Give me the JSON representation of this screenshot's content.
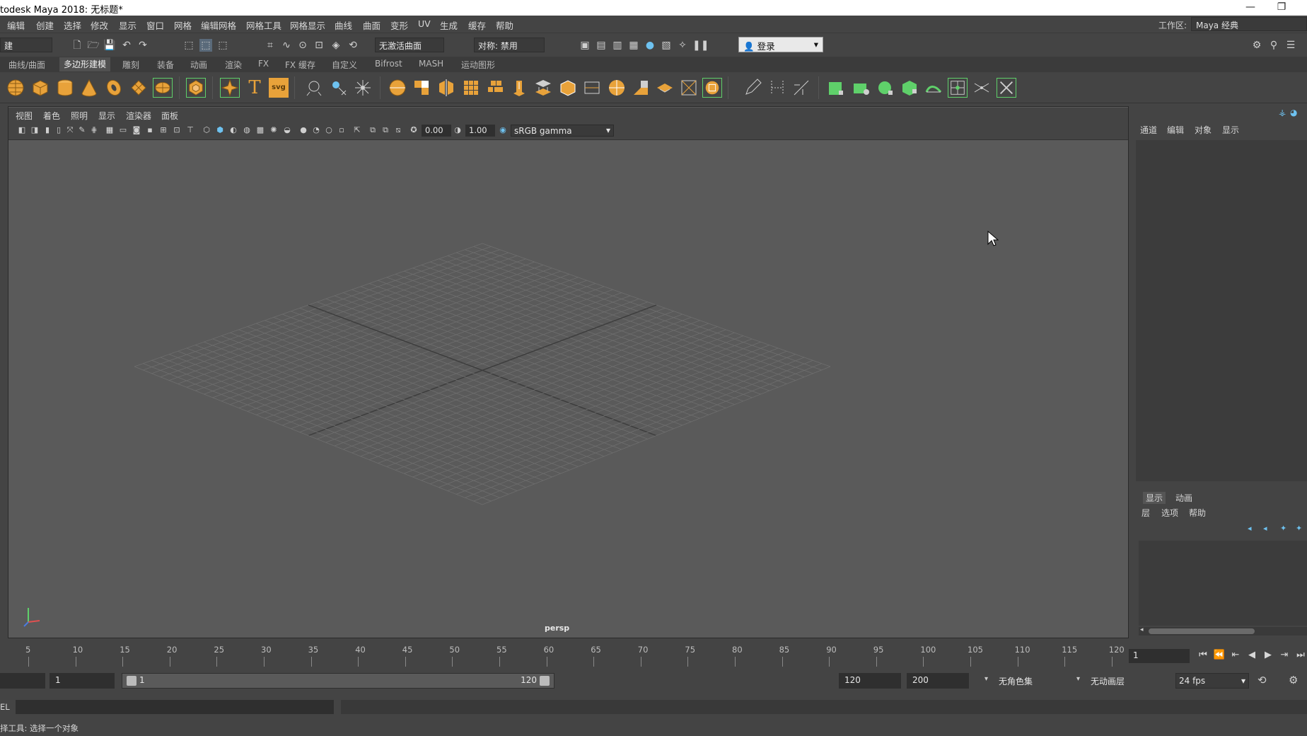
{
  "window": {
    "title": "todesk Maya 2018: 无标题*",
    "minimize": "—",
    "restore": "❐"
  },
  "menubar": {
    "items": [
      "编辑",
      "创建",
      "选择",
      "修改",
      "显示",
      "窗口",
      "网格",
      "编辑网格",
      "网格工具",
      "网格显示",
      "曲线",
      "曲面",
      "变形",
      "UV",
      "生成",
      "缓存",
      "帮助"
    ],
    "workspace_label": "工作区:",
    "workspace_value": "Maya 经典"
  },
  "statusline": {
    "mode_menu": "建",
    "live_surface": "无激活曲面",
    "symmetry": "对称: 禁用",
    "login": "登录"
  },
  "shelf": {
    "tabs": [
      "曲线/曲面",
      "多边形建模",
      "雕刻",
      "装备",
      "动画",
      "渲染",
      "FX",
      "FX 缓存",
      "自定义",
      "Bifrost",
      "MASH",
      "运动图形"
    ],
    "active_tab": "多边形建模",
    "text_icon": "T",
    "svg_icon": "svg"
  },
  "viewport": {
    "menu": [
      "视图",
      "着色",
      "照明",
      "显示",
      "渲染器",
      "面板"
    ],
    "exposure": "0.00",
    "gamma": "1.00",
    "color_space": "sRGB gamma",
    "camera_label": "persp"
  },
  "right_panel": {
    "channel_tabs": [
      "通道",
      "编辑",
      "对象",
      "显示"
    ],
    "layer_tabs": [
      "显示",
      "动画"
    ],
    "layer_menu": [
      "层",
      "选项",
      "帮助"
    ]
  },
  "timeslider": {
    "ticks": [
      "5",
      "10",
      "15",
      "20",
      "25",
      "30",
      "35",
      "40",
      "45",
      "50",
      "55",
      "60",
      "65",
      "70",
      "75",
      "80",
      "85",
      "90",
      "95",
      "100",
      "105",
      "110",
      "115",
      "120"
    ],
    "current_frame": "1"
  },
  "rangeslider": {
    "start_time": "1",
    "range_start": "1",
    "range_end": "120",
    "end_time": "120",
    "anim_end": "200",
    "character_set": "无角色集",
    "anim_layer": "无动画层",
    "fps": "24 fps"
  },
  "commandline": {
    "label": "EL"
  },
  "helpline": {
    "text": "择工具: 选择一个对象"
  },
  "colors": {
    "bg": "#444444",
    "viewport": "#5a5a5a",
    "grid": "#6e6e6e",
    "grid_axis": "#3c3c3c",
    "shelf_orange": "#e8a23a",
    "shelf_green": "#5fd06a"
  }
}
